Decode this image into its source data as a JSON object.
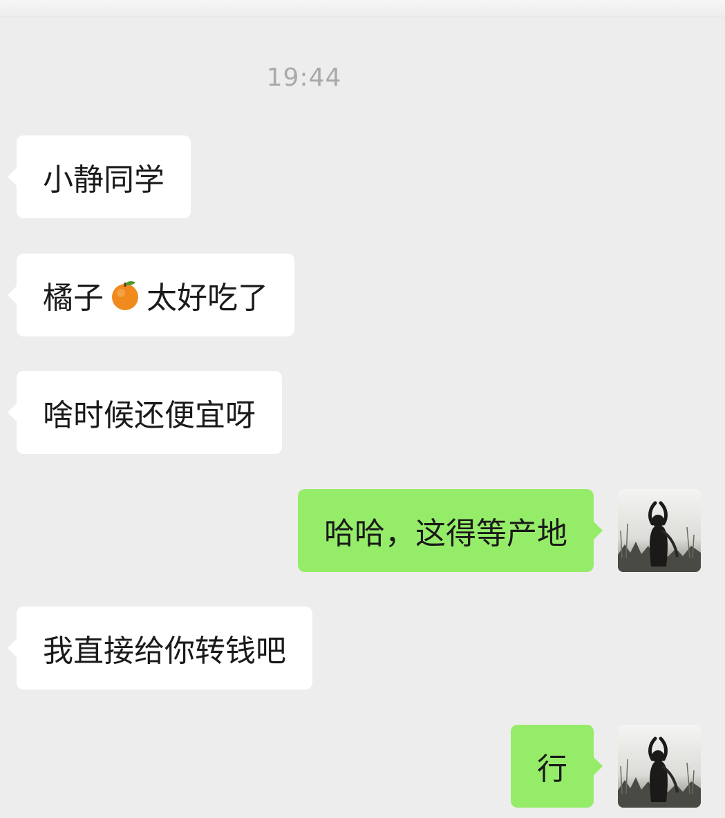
{
  "timestamp": "19:44",
  "messages": [
    {
      "side": "left",
      "text": "小静同学"
    },
    {
      "side": "left",
      "text_before": "橘子",
      "icon": "orange-emoji-icon",
      "text_after": "太好吃了"
    },
    {
      "side": "left",
      "text": "啥时候还便宜呀"
    },
    {
      "side": "right",
      "text": "哈哈，这得等产地"
    },
    {
      "side": "left",
      "text": "我直接给你转钱吧"
    },
    {
      "side": "right",
      "text": "行"
    }
  ],
  "colors": {
    "background": "#ededed",
    "incoming_bubble": "#ffffff",
    "outgoing_bubble": "#95ec69",
    "timestamp_text": "#a9a9a9"
  }
}
